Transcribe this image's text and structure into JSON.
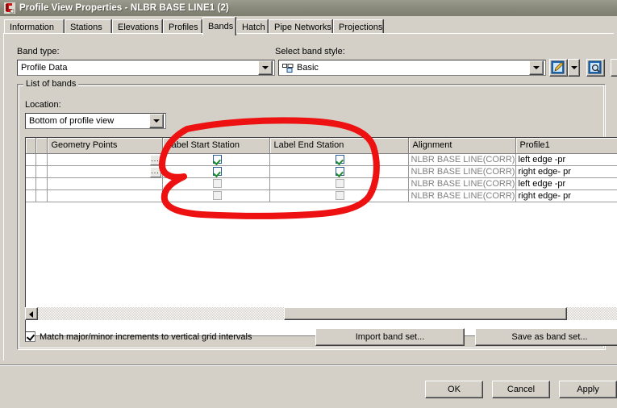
{
  "window": {
    "title": "Profile View Properties - NLBR BASE LINE1 (2)",
    "icon": "autocad-civil3d-icon"
  },
  "tabs": [
    {
      "label": "Information",
      "active": false
    },
    {
      "label": "Stations",
      "active": false
    },
    {
      "label": "Elevations",
      "active": false
    },
    {
      "label": "Profiles",
      "active": false
    },
    {
      "label": "Bands",
      "active": true
    },
    {
      "label": "Hatch",
      "active": false
    },
    {
      "label": "Pipe Networks",
      "active": false
    },
    {
      "label": "Projections",
      "active": false
    }
  ],
  "band_type": {
    "label": "Band type:",
    "value": "Profile Data"
  },
  "band_style": {
    "label": "Select band style:",
    "value": "Basic",
    "icon": "band-style-icon",
    "edit_button": "edit-style-icon",
    "edit_dropdown": "edit-style-dropdown-arrow",
    "preview_button": "preview-style-icon"
  },
  "list_of_bands": {
    "title": "List of bands",
    "location": {
      "label": "Location:",
      "value": "Bottom of profile view"
    },
    "grid": {
      "columns": [
        "",
        "",
        "Geometry Points",
        "Label Start Station",
        "Label End Station",
        "Alignment",
        "Profile1"
      ],
      "rows": [
        {
          "geometry_points": "",
          "has_ellipsis": true,
          "label_start_station": true,
          "label_end_station": true,
          "alignment": "NLBR BASE LINE(CORR)",
          "profile1": "left edge -pr"
        },
        {
          "geometry_points": "",
          "has_ellipsis": true,
          "label_start_station": true,
          "label_end_station": true,
          "alignment": "NLBR BASE LINE(CORR)",
          "profile1": "right edge- pr"
        },
        {
          "geometry_points": "",
          "has_ellipsis": false,
          "label_start_station": false,
          "label_end_station": false,
          "alignment": "NLBR BASE LINE(CORR)",
          "profile1": "left edge -pr"
        },
        {
          "geometry_points": "",
          "has_ellipsis": false,
          "label_start_station": false,
          "label_end_station": false,
          "alignment": "NLBR BASE LINE(CORR)",
          "profile1": "right edge- pr"
        }
      ]
    },
    "match_increments": {
      "label": "Match major/minor increments to vertical grid intervals",
      "checked": true
    },
    "import_button": "Import band set...",
    "save_button": "Save as band set..."
  },
  "dialog_buttons": {
    "ok": "OK",
    "cancel": "Cancel",
    "apply": "Apply"
  },
  "annotation": {
    "type": "hand-drawn-red-oval",
    "color": "#ee1111",
    "target": "Label Start Station and Label End Station columns"
  }
}
